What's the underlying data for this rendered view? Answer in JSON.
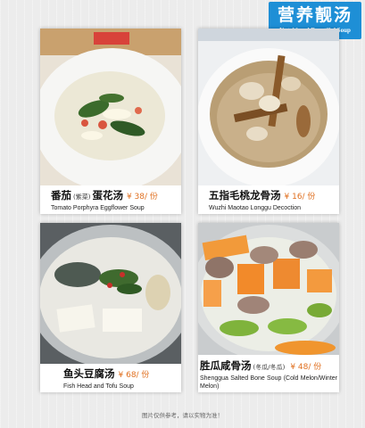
{
  "header": {
    "title_zh": "营养靓汤",
    "title_en": "Nutritional Beautiful Soup"
  },
  "dishes": [
    {
      "name": "番茄",
      "sub": "(紫菜)",
      "name2": "蛋花汤",
      "price": "¥ 38/ 份",
      "english": "Tomato Porphyra Eggflower Soup"
    },
    {
      "name": "五指毛桃龙骨汤",
      "sub": "",
      "name2": "",
      "price": "¥ 16/ 份",
      "english": "Wuzhi Maotao Longgu Decoction"
    },
    {
      "name": "鱼头豆腐汤",
      "sub": "",
      "name2": "",
      "price": "¥ 68/ 份",
      "english": "Fish Head and Tofu Soup"
    },
    {
      "name": "胜瓜咸骨汤",
      "sub": "(冬瓜/冬瓜)",
      "name2": "",
      "price": "¥ 48/ 份",
      "english": "Shenggua Salted Bone Soup (Cold Melon/Winter Melon)"
    }
  ],
  "footer": {
    "note": "图片仅供参考，请以实物为准！"
  },
  "colors": {
    "badge": "#1e8fd6",
    "price": "#e07020"
  }
}
